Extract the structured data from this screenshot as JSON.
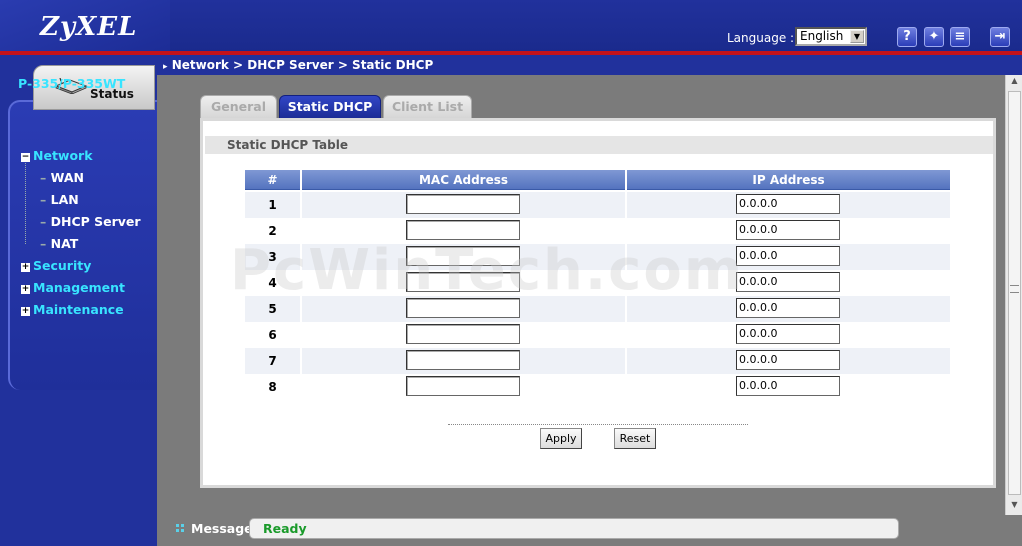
{
  "header": {
    "logo": "ZyXEL",
    "language_label": "Language :",
    "language_value": "English",
    "icons": [
      "help-icon",
      "wizard-icon",
      "log-icon",
      "logout-icon"
    ]
  },
  "sidebar": {
    "status_tab": "Status",
    "model": "P-335/P-335WT",
    "items": [
      {
        "label": "Network",
        "expanded": true
      },
      {
        "label": "WAN"
      },
      {
        "label": "LAN"
      },
      {
        "label": "DHCP Server"
      },
      {
        "label": "NAT"
      },
      {
        "label": "Security",
        "expanded": false
      },
      {
        "label": "Management",
        "expanded": false
      },
      {
        "label": "Maintenance",
        "expanded": false
      }
    ]
  },
  "breadcrumb": "Network > DHCP Server > Static DHCP",
  "tabs": [
    {
      "label": "General",
      "active": false
    },
    {
      "label": "Static DHCP",
      "active": true
    },
    {
      "label": "Client List",
      "active": false
    }
  ],
  "section_title": "Static DHCP Table",
  "table": {
    "headers": [
      "#",
      "MAC Address",
      "IP Address"
    ],
    "rows": [
      {
        "num": "1",
        "mac": "",
        "ip": "0.0.0.0"
      },
      {
        "num": "2",
        "mac": "",
        "ip": "0.0.0.0"
      },
      {
        "num": "3",
        "mac": "",
        "ip": "0.0.0.0"
      },
      {
        "num": "4",
        "mac": "",
        "ip": "0.0.0.0"
      },
      {
        "num": "5",
        "mac": "",
        "ip": "0.0.0.0"
      },
      {
        "num": "6",
        "mac": "",
        "ip": "0.0.0.0"
      },
      {
        "num": "7",
        "mac": "",
        "ip": "0.0.0.0"
      },
      {
        "num": "8",
        "mac": "",
        "ip": "0.0.0.0"
      }
    ]
  },
  "buttons": {
    "apply": "Apply",
    "reset": "Reset"
  },
  "watermark": "PcWinTech.com",
  "message": {
    "label": "Message",
    "status": "Ready"
  },
  "colors": {
    "header_blue": "#21319c",
    "accent_red": "#c4121a",
    "status_green": "#1a9a2a",
    "menu_cyan": "#38e4ff"
  }
}
